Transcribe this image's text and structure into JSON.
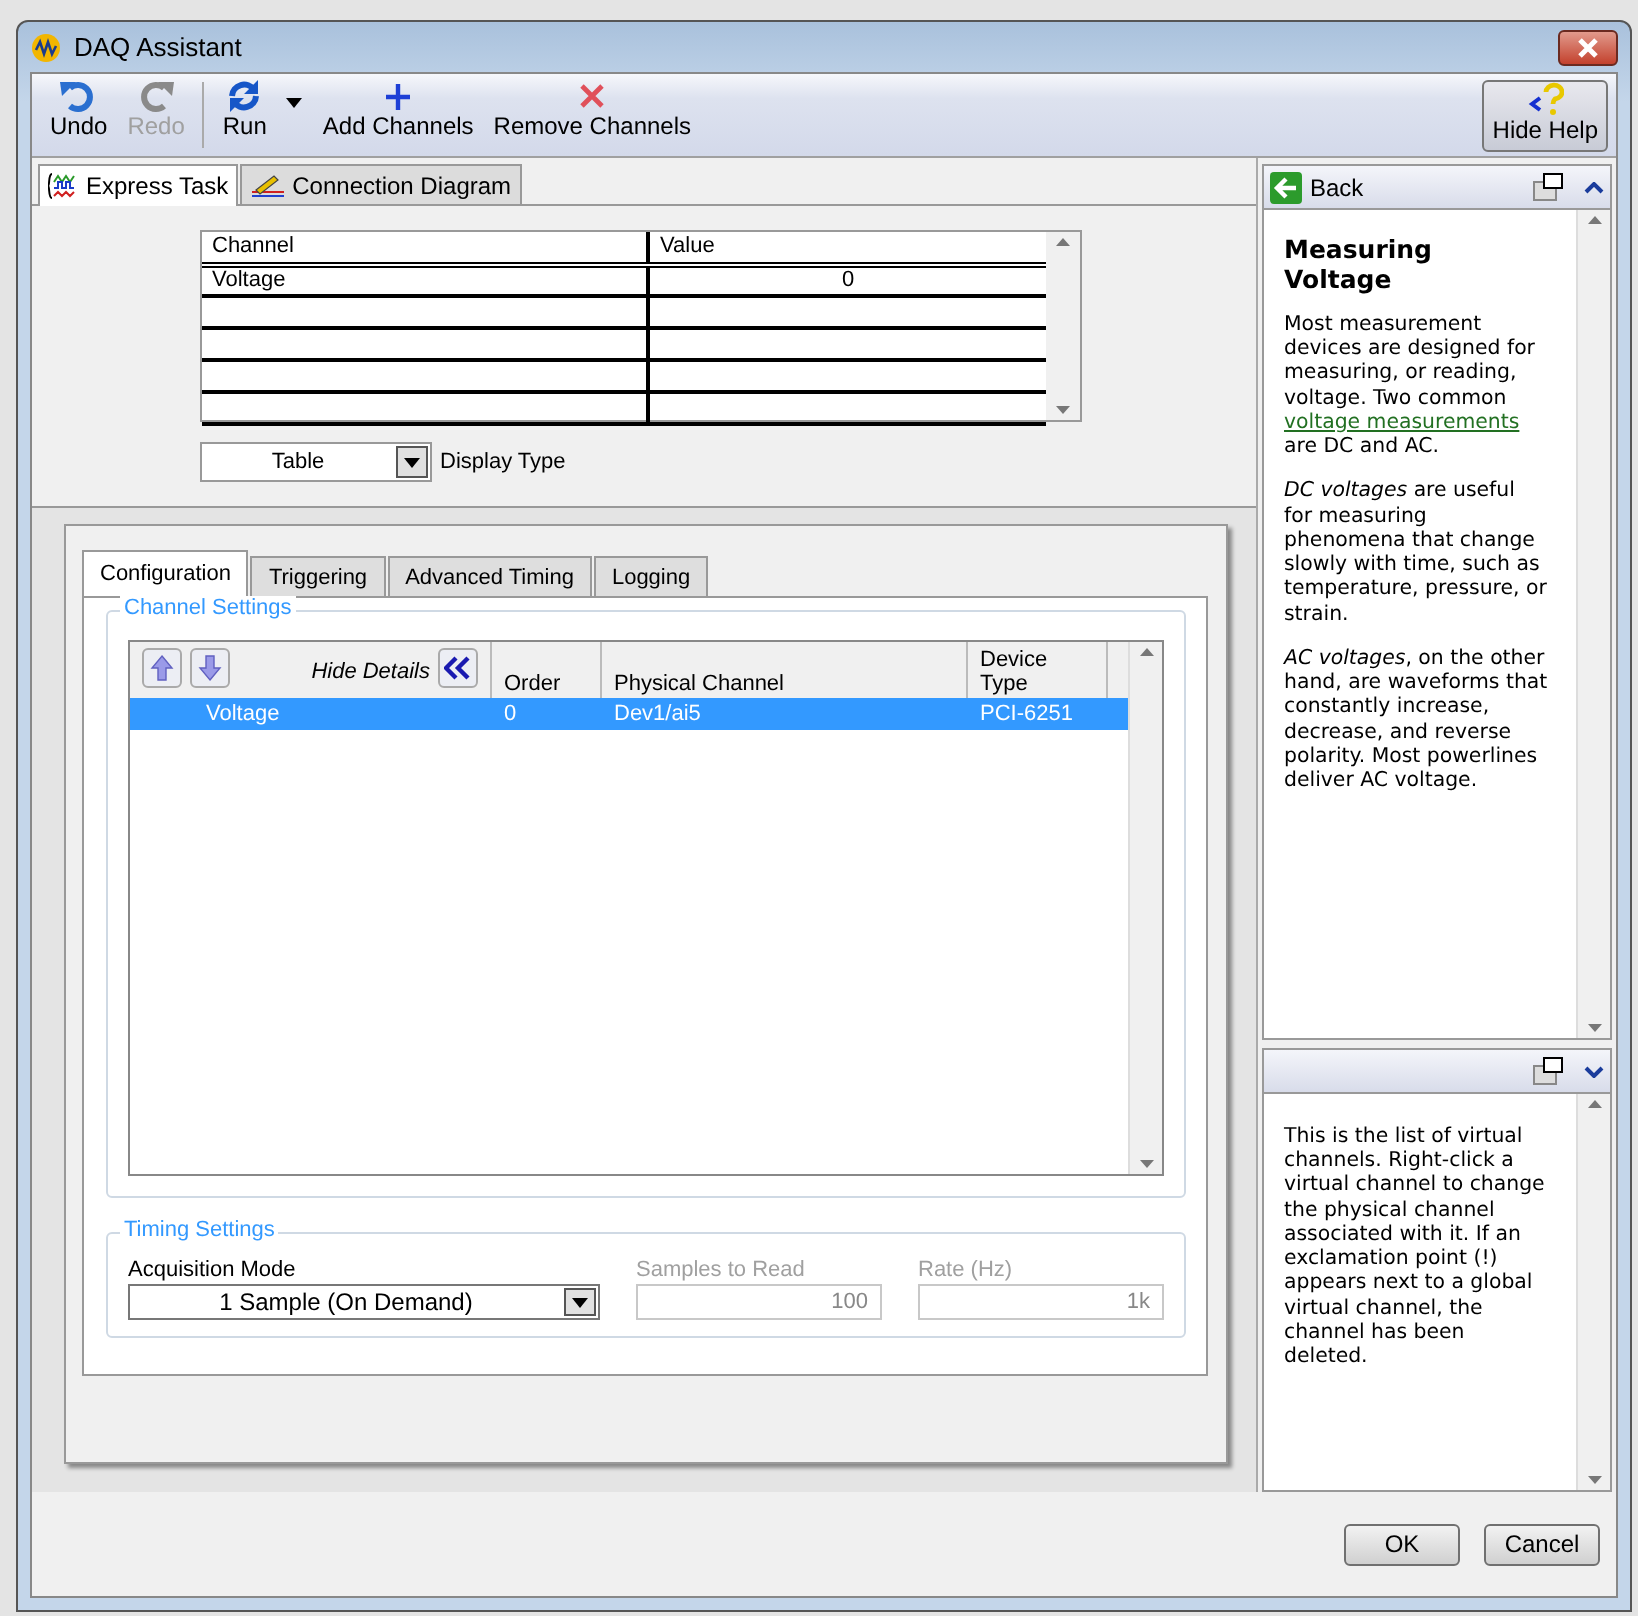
{
  "window": {
    "title": "DAQ Assistant"
  },
  "toolbar": [
    {
      "label": "Undo",
      "kind": "undo",
      "disabled": false
    },
    {
      "label": "Redo",
      "kind": "redo",
      "disabled": true
    },
    {
      "label": "Run",
      "kind": "run",
      "disabled": false
    },
    {
      "label": "Add Channels",
      "kind": "add",
      "disabled": false
    },
    {
      "label": "Remove Channels",
      "kind": "remove",
      "disabled": false
    }
  ],
  "help_toggle": {
    "label": "Hide Help"
  },
  "view_tabs": [
    {
      "label": "Express Task",
      "kind": "task",
      "selected": true
    },
    {
      "label": "Connection Diagram",
      "kind": "diagram",
      "selected": false
    }
  ],
  "preview_table": {
    "columns": [
      "Channel",
      "Value"
    ],
    "rows": [
      [
        "Voltage",
        "0"
      ]
    ]
  },
  "display_type": {
    "value": "Table",
    "label": "Display Type"
  },
  "config_tabs": [
    {
      "label": "Configuration",
      "selected": true
    },
    {
      "label": "Triggering",
      "selected": false
    },
    {
      "label": "Advanced Timing",
      "selected": false
    },
    {
      "label": "Logging",
      "selected": false
    }
  ],
  "channel_settings": {
    "title": "Channel Settings",
    "hide_details": "Hide Details",
    "columns": [
      "Order",
      "Physical Channel",
      "Device Type"
    ],
    "rows": [
      {
        "name": "Voltage",
        "order": "0",
        "physical_channel": "Dev1/ai5",
        "device_type": "PCI-6251",
        "selected": true
      }
    ]
  },
  "timing_settings": {
    "title": "Timing Settings",
    "fields": [
      {
        "label": "Acquisition Mode",
        "value": "1 Sample (On Demand)",
        "kind": "dropdown",
        "disabled": false
      },
      {
        "label": "Samples to Read",
        "value": "100",
        "kind": "text",
        "disabled": true
      },
      {
        "label": "Rate (Hz)",
        "value": "1k",
        "kind": "text",
        "disabled": true
      }
    ]
  },
  "help": {
    "back": "Back",
    "title": "Measuring Voltage",
    "intro": {
      "before": "Most measurement devices are designed for measuring, or reading, voltage. Two common ",
      "link": "voltage measurements",
      "after": " are DC and AC."
    },
    "paragraphs": [
      "*DC voltages* are useful for measuring phenomena that change slowly with time, such as temperature, pressure, or strain.",
      "*AC voltages*, on the other hand, are waveforms that constantly increase, decrease, and reverse polarity. Most powerlines deliver AC voltage."
    ],
    "context_help": "This is the list of virtual channels. Right-click a virtual channel to change the physical channel associated with it. If an exclamation point (!) appears next to a global virtual channel, the channel has been deleted."
  },
  "buttons": [
    "OK",
    "Cancel"
  ]
}
